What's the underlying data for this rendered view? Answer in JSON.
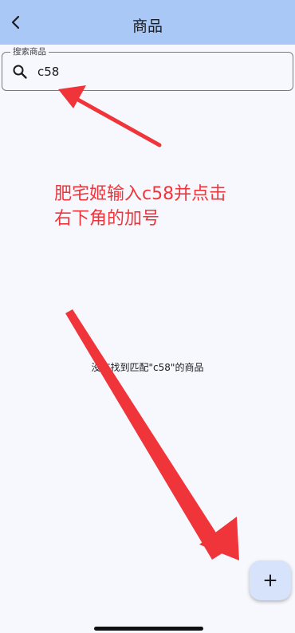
{
  "appbar": {
    "title": "商品",
    "back_icon": "arrow-back-icon"
  },
  "search": {
    "label": "搜索商品",
    "value": "c58",
    "icon": "search-icon"
  },
  "annotation": {
    "line1": "肥宅姬输入c58并点击",
    "line2": "右下角的加号",
    "color": "#f0353a"
  },
  "empty_state": {
    "message": "没有找到匹配\"c58\"的商品"
  },
  "fab": {
    "icon": "plus-icon",
    "label": "+"
  },
  "colors": {
    "appbar_bg": "#a9c8f5",
    "page_bg": "#f7f8fd",
    "fab_bg": "#d6e3fa",
    "arrow": "#f0353a"
  }
}
